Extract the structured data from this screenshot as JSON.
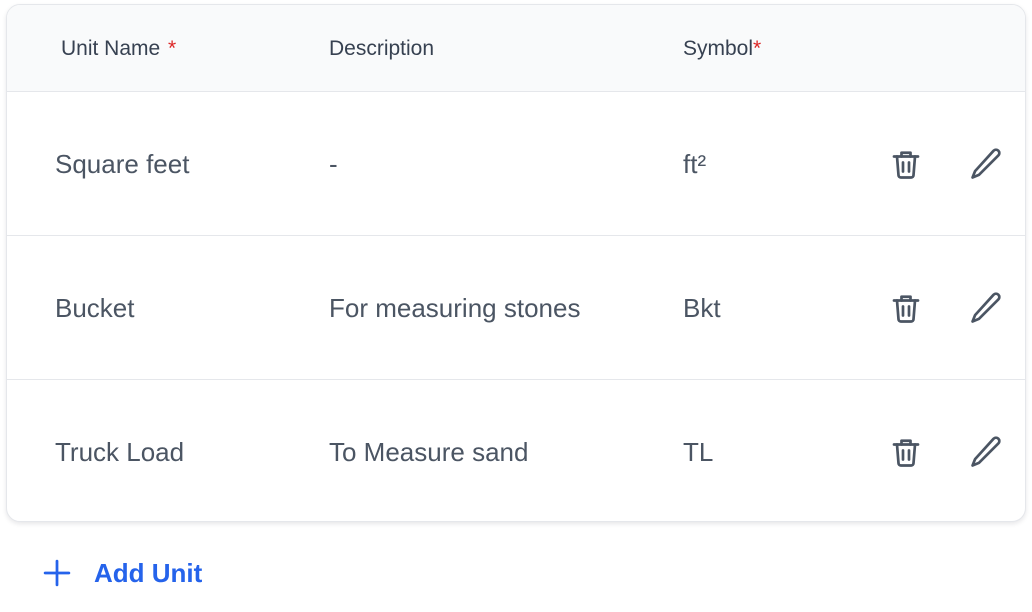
{
  "table": {
    "headers": {
      "unit_name": "Unit Name",
      "unit_name_required": "*",
      "description": "Description",
      "symbol": "Symbol",
      "symbol_required": "*"
    },
    "rows": [
      {
        "unit_name": "Square feet",
        "description": "-",
        "symbol": "ft²"
      },
      {
        "unit_name": "Bucket",
        "description": "For measuring stones",
        "symbol": "Bkt"
      },
      {
        "unit_name": "Truck Load",
        "description": "To Measure sand",
        "symbol": "TL"
      }
    ],
    "row_actions": [
      "trash-icon",
      "pencil-icon"
    ]
  },
  "add_unit": {
    "label": "Add Unit",
    "icon": "plus-icon"
  },
  "colors": {
    "accent": "#2563eb",
    "required": "#dc2626",
    "text": "#4b5563",
    "header_text": "#374151",
    "icon": "#4b5563",
    "border": "#e5e7eb",
    "header_bg": "#f9fafb"
  }
}
